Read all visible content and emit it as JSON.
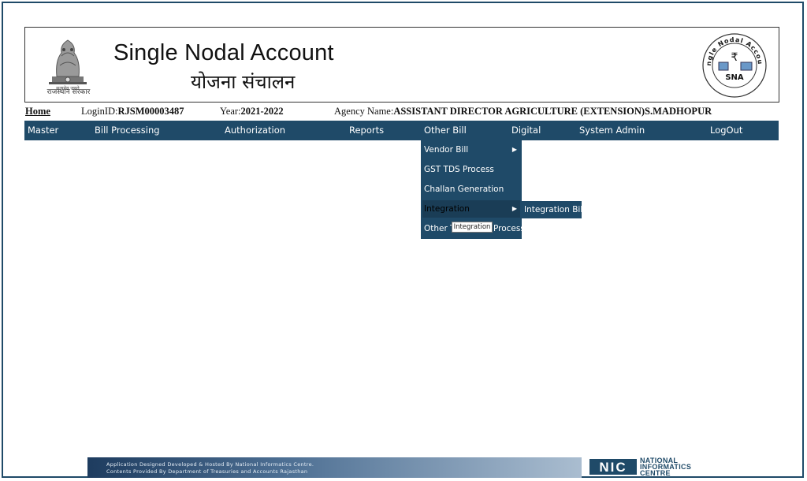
{
  "header": {
    "title_en": "Single Nodal Account",
    "title_hi": "योजना संचालन",
    "emblem_caption": "राजस्थान सरकार",
    "emblem_motto": "सत्यमेव जयते",
    "sna_logo_ring_text": "Single Nodal Account",
    "sna_logo_abbr": "SNA",
    "sna_logo_symbol": "₹"
  },
  "infobar": {
    "home_label": "Home",
    "login_label": "LoginID:",
    "login_value": "RJSM00003487",
    "year_label": "Year:",
    "year_value": "2021-2022",
    "agency_label": "Agency Name:",
    "agency_value": "ASSISTANT DIRECTOR AGRICULTURE (EXTENSION)S.MADHOPUR"
  },
  "menubar": {
    "items": [
      "Master",
      "Bill Processing",
      "Authorization",
      "Reports",
      "Other Bill",
      "Digital",
      "System Admin",
      "LogOut"
    ]
  },
  "dropdown": {
    "items": [
      "Vendor Bill",
      "GST TDS Process",
      "Challan Generation",
      "Integration",
      "Other T"
    ],
    "item_suffix_after_tooltip": "Process",
    "submenu_item": "Integration Bill",
    "tooltip": "Integration"
  },
  "footer": {
    "line1": "Application Designed Developed & Hosted By National Informatics Centre.",
    "line2": "Contents Provided By Department of Treasuries and Accounts Rajasthan",
    "nic_logo_text": "NIC",
    "nic_text_1": "NATIONAL",
    "nic_text_2": "INFORMATICS",
    "nic_text_3": "CENTRE"
  },
  "colors": {
    "menu_bg": "#1f4a68",
    "frame_border": "#1f4a68"
  }
}
